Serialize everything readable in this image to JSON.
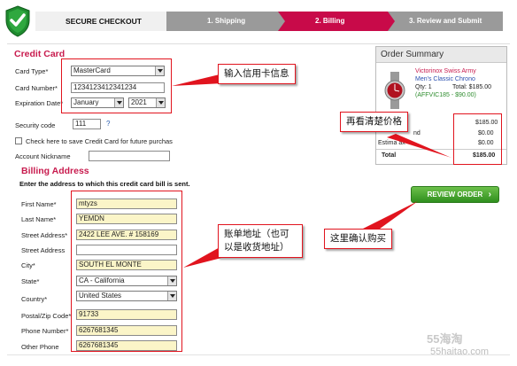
{
  "header": {
    "title": "SECURE CHECKOUT",
    "steps": [
      "1. Shipping",
      "2. Billing",
      "3. Review and Submit"
    ],
    "active_color": "#c80a49",
    "inactive_color": "#9a9a9a"
  },
  "credit_card": {
    "title": "Credit Card",
    "card_type_label": "Card Type*",
    "card_type_value": "MasterCard",
    "card_number_label": "Card Number*",
    "card_number_value": "1234123412341234",
    "expiration_label": "Expiration Date*",
    "exp_month": "January",
    "exp_year": "2021",
    "security_label": "Security code",
    "security_value": "111",
    "security_help": "?",
    "save_label": "Check here to save Credit Card for future purchase",
    "nickname_label": "Account Nickname",
    "nickname_value": ""
  },
  "billing": {
    "title": "Billing Address",
    "note": "Enter the address to which this credit card bill is sent.",
    "fields": [
      {
        "label": "First Name*",
        "value": "mtyzs"
      },
      {
        "label": "Last Name*",
        "value": "YEMDN"
      },
      {
        "label": "Street Address*",
        "value": "2422 LEE AVE. # 158169"
      },
      {
        "label": "Street Address",
        "value": ""
      },
      {
        "label": "City*",
        "value": "SOUTH EL MONTE"
      },
      {
        "label": "State*",
        "value": "CA - California"
      },
      {
        "label": "Country*",
        "value": "United States"
      },
      {
        "label": "Postal/Zip Code*",
        "value": "91733"
      },
      {
        "label": "Phone Number*",
        "value": "6267681345"
      },
      {
        "label": "Other Phone",
        "value": "6267681345"
      }
    ]
  },
  "order_summary": {
    "title": "Order Summary",
    "product_brand": "Victorinox Swiss Army",
    "product_name": "Men's Classic Chrono",
    "qty": "Qty: 1",
    "total_item": "Total: $185.00",
    "item_code": "(AFFVIC185 - $90.00)",
    "subtotal": "$185.00",
    "shipping_label": "nd",
    "shipping_value": "$0.00",
    "tax_label": "Estima    ax",
    "tax_value": "$0.00",
    "total_label": "Total",
    "total_value": "$185.00"
  },
  "review_button": {
    "label": "REVIEW ORDER",
    "arrow": "›"
  },
  "annotations": {
    "card_info": "输入信用卡信息",
    "price_check": "再看清楚价格",
    "billing_addr": "账单地址（也可以是收货地址）",
    "confirm": "这里确认购买"
  },
  "watermark": {
    "brand": "55海淘",
    "site": "55haitao.com"
  }
}
